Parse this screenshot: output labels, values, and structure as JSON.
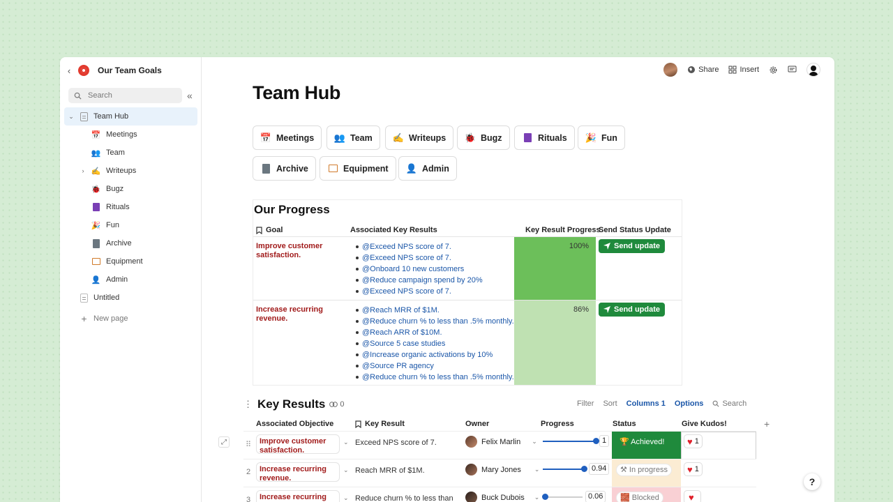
{
  "doc": {
    "title": "Our Team Goals"
  },
  "sidebar": {
    "search_placeholder": "Search",
    "items": [
      {
        "label": "Team Hub",
        "icon": "page-icon",
        "level": 0,
        "expanded": true,
        "active": true
      },
      {
        "label": "Meetings",
        "icon": "calendar-icon",
        "level": 1
      },
      {
        "label": "Team",
        "icon": "people-icon",
        "level": 1
      },
      {
        "label": "Writeups",
        "icon": "writing-hand-icon",
        "level": 1,
        "expandable": true
      },
      {
        "label": "Bugz",
        "icon": "bug-icon",
        "level": 1
      },
      {
        "label": "Rituals",
        "icon": "book-icon",
        "level": 1
      },
      {
        "label": "Fun",
        "icon": "party-icon",
        "level": 1
      },
      {
        "label": "Archive",
        "icon": "cabinet-icon",
        "level": 1
      },
      {
        "label": "Equipment",
        "icon": "devices-icon",
        "level": 1
      },
      {
        "label": "Admin",
        "icon": "admin-person-icon",
        "level": 1
      },
      {
        "label": "Untitled",
        "icon": "page-icon",
        "level": 0
      }
    ],
    "new_page": "New page"
  },
  "toolbar": {
    "share": "Share",
    "insert": "Insert"
  },
  "page": {
    "title": "Team Hub"
  },
  "chips": [
    {
      "label": "Meetings",
      "icon": "calendar-icon"
    },
    {
      "label": "Team",
      "icon": "people-icon"
    },
    {
      "label": "Writeups",
      "icon": "writing-hand-icon"
    },
    {
      "label": "Bugz",
      "icon": "bug-icon"
    },
    {
      "label": "Rituals",
      "icon": "book-icon"
    },
    {
      "label": "Fun",
      "icon": "party-icon"
    },
    {
      "label": "Archive",
      "icon": "cabinet-icon"
    },
    {
      "label": "Equipment",
      "icon": "devices-icon"
    },
    {
      "label": "Admin",
      "icon": "admin-person-icon"
    }
  ],
  "progress": {
    "title": "Our Progress",
    "headers": {
      "goal": "Goal",
      "kr": "Associated Key Results",
      "progress": "Key Result Progress",
      "send": "Send Status Update"
    },
    "rows": [
      {
        "goal": "Improve customer satisfaction.",
        "results": [
          "@Exceed NPS score of 7.",
          "@Exceed NPS score of 7.",
          "@Onboard 10 new customers",
          "@Reduce campaign spend by 20%",
          "@Exceed NPS score of 7."
        ],
        "pct": "100%",
        "pct_value": 1.0,
        "cell_color": "#6cbf5a",
        "button": "Send update"
      },
      {
        "goal": "Increase recurring revenue.",
        "results": [
          "@Reach MRR of $1M.",
          "@Reduce churn % to less than .5% monthly.",
          "@Reach ARR of $10M.",
          "@Source 5 case studies",
          "@Increase organic activations by 10%",
          "@Source PR agency",
          "@Reduce churn % to less than .5% monthly."
        ],
        "pct": "86%",
        "pct_value": 0.86,
        "cell_color": "#bfe1b2",
        "button": "Send update"
      }
    ]
  },
  "key_results": {
    "title": "Key Results",
    "link_count": "0",
    "actions": {
      "filter": "Filter",
      "sort": "Sort",
      "columns": "Columns 1",
      "options": "Options",
      "search": "Search"
    },
    "headers": {
      "objective": "Associated Objective",
      "kr": "Key Result",
      "owner": "Owner",
      "progress": "Progress",
      "status": "Status",
      "kudos": "Give Kudos!"
    },
    "rows": [
      {
        "num": "",
        "objective": "Improve customer satisfaction.",
        "kr": "Exceed NPS score of 7.",
        "owner": "Felix Marlin",
        "progress": 1,
        "progress_label": "1",
        "status": "🏆 Achieved!",
        "status_color": "#1f8a3c",
        "status_text_color": "#ffffff",
        "kudos": "1"
      },
      {
        "num": "2",
        "objective": "Increase recurring revenue.",
        "kr": "Reach MRR of $1M.",
        "owner": "Mary Jones",
        "progress": 0.94,
        "progress_label": "0.94",
        "status": "⚒ In progress",
        "status_color": "#fbecd3",
        "status_text_color": "#777777",
        "kudos": "1"
      },
      {
        "num": "3",
        "objective": "Increase recurring",
        "kr": "Reduce churn % to less than",
        "owner": "Buck Dubois",
        "progress": 0.06,
        "progress_label": "0.06",
        "status": "🧱 Blocked",
        "status_color": "#f9d0d4",
        "status_text_color": "#777777",
        "kudos": ""
      }
    ]
  }
}
